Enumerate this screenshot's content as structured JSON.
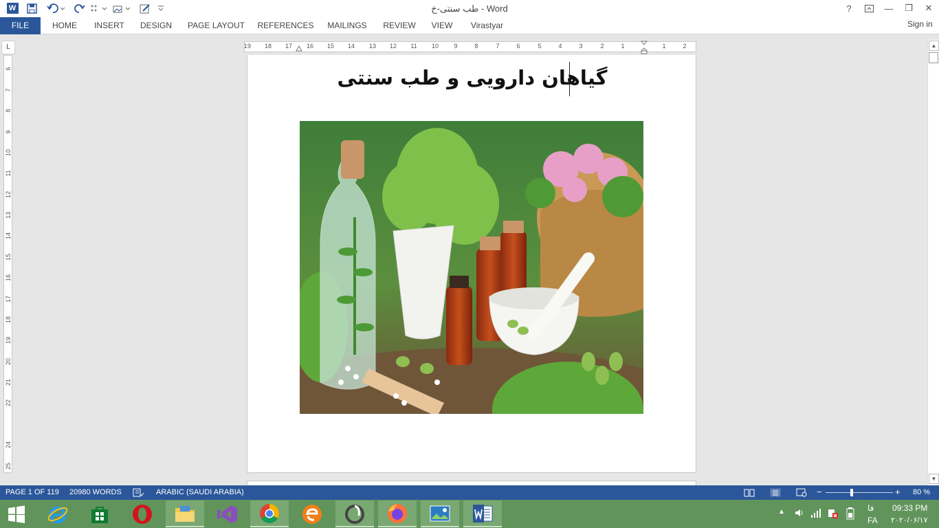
{
  "window": {
    "title": "طب سنتی-خ - Word"
  },
  "title_bar": {
    "help": "?",
    "minimize": "—",
    "restore": "❐",
    "close": "✕",
    "word_logo_letter": "W"
  },
  "ribbon_tabs": [
    {
      "label": "FILE",
      "active": true
    },
    {
      "label": "HOME"
    },
    {
      "label": "INSERT"
    },
    {
      "label": "DESIGN"
    },
    {
      "label": "PAGE LAYOUT"
    },
    {
      "label": "REFERENCES"
    },
    {
      "label": "MAILINGS"
    },
    {
      "label": "REVIEW"
    },
    {
      "label": "VIEW"
    },
    {
      "label": "Virastyar"
    }
  ],
  "sign_in": "Sign in",
  "ruler": {
    "corner": "L",
    "horizontal_ticks": [
      "19",
      "18",
      "17",
      "16",
      "15",
      "14",
      "13",
      "12",
      "11",
      "10",
      "9",
      "8",
      "7",
      "6",
      "5",
      "4",
      "3",
      "2",
      "1",
      "1",
      "2"
    ],
    "vertical_ticks": [
      "6",
      "7",
      "8",
      "9",
      "10",
      "11",
      "12",
      "13",
      "14",
      "15",
      "16",
      "17",
      "18",
      "19",
      "20",
      "21",
      "22",
      "24",
      "25"
    ]
  },
  "document": {
    "heading": "گیاهان دارویی و طب سنتی"
  },
  "status_bar": {
    "page": "PAGE 1 OF 119",
    "words": "20980 WORDS",
    "language": "ARABIC (SAUDI ARABIA)",
    "zoom_out": "−",
    "zoom_in": "+",
    "zoom": "80 %",
    "zoom_value": 80
  },
  "taskbar": {
    "lang_top": "فا",
    "lang_bottom": "FA",
    "time": "09:33 PM",
    "date": "۲۰۲۰/۰۶/۱۷"
  },
  "icons": {
    "word": "word-icon",
    "save": "save-icon",
    "undo": "undo-icon",
    "redo": "redo-icon",
    "start": "windows-icon",
    "ie": "internet-explorer-icon",
    "store": "store-icon",
    "opera": "opera-icon",
    "explorer": "folder-icon",
    "vs": "visual-studio-icon",
    "chrome": "chrome-icon",
    "eset": "eset-icon",
    "firefox": "firefox-icon",
    "photos": "photos-icon"
  },
  "colors": {
    "word_blue": "#2b579a",
    "taskbar_green": "#61945b"
  }
}
